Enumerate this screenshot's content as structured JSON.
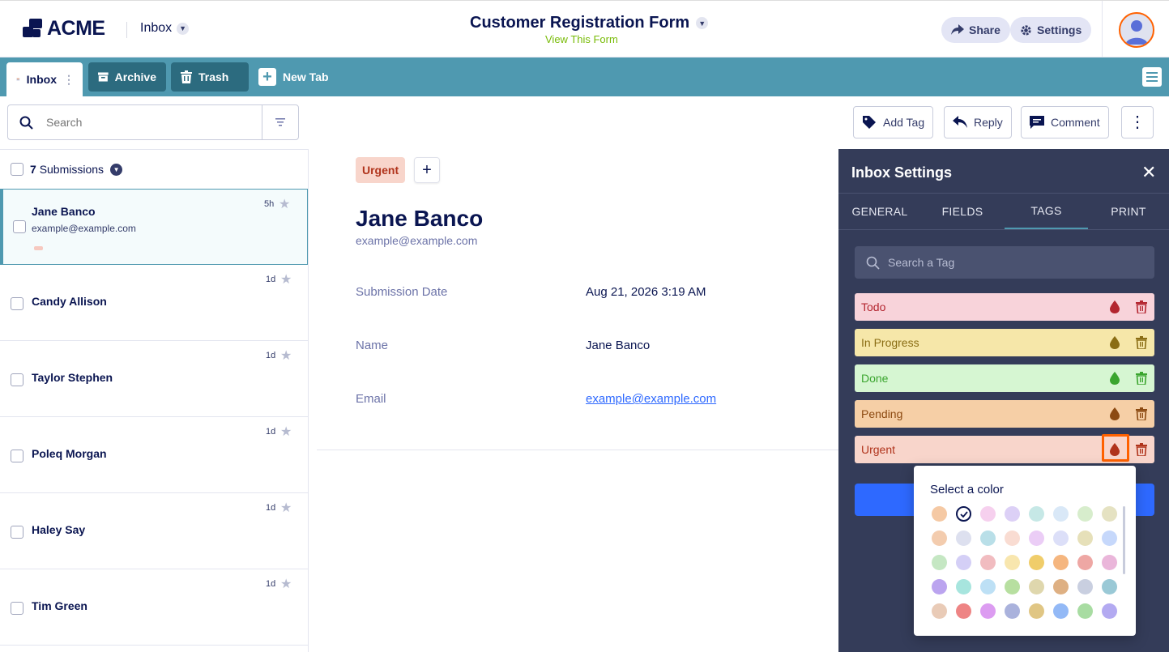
{
  "header": {
    "logo_text": "ACME",
    "inbox_label": "Inbox",
    "form_title": "Customer Registration Form",
    "form_link": "View This Form",
    "share_label": "Share",
    "settings_label": "Settings"
  },
  "tabs": {
    "inbox": "Inbox",
    "archive": "Archive",
    "trash": "Trash",
    "new_tab": "New Tab"
  },
  "toolbar": {
    "search_placeholder": "Search",
    "add_tag": "Add Tag",
    "reply": "Reply",
    "comment": "Comment"
  },
  "list": {
    "count": "7",
    "count_label": "Submissions",
    "rows": [
      {
        "name": "Jane Banco",
        "email": "example@example.com",
        "age": "5h"
      },
      {
        "name": "Candy Allison",
        "age": "1d"
      },
      {
        "name": "Taylor Stephen",
        "age": "1d"
      },
      {
        "name": "Poleq Morgan",
        "age": "1d"
      },
      {
        "name": "Haley Say",
        "age": "1d"
      },
      {
        "name": "Tim Green",
        "age": "1d"
      }
    ]
  },
  "detail": {
    "tag": "Urgent",
    "name": "Jane Banco",
    "email": "example@example.com",
    "fields": [
      {
        "label": "Submission Date",
        "value": "Aug 21, 2026 3:19 AM"
      },
      {
        "label": "Name",
        "value": "Jane Banco"
      },
      {
        "label": "Email",
        "value": "example@example.com"
      }
    ]
  },
  "settings": {
    "title": "Inbox Settings",
    "tabs": [
      "GENERAL",
      "FIELDS",
      "TAGS",
      "PRINT"
    ],
    "active_tab": "TAGS",
    "tag_search_placeholder": "Search a Tag",
    "tags": [
      {
        "name": "Todo",
        "bg": "#f8d3da",
        "fg": "#b3252f"
      },
      {
        "name": "In Progress",
        "bg": "#f6e7a9",
        "fg": "#8a6d14"
      },
      {
        "name": "Done",
        "bg": "#d6f6d2",
        "fg": "#3aa52e"
      },
      {
        "name": "Pending",
        "bg": "#f6cfa6",
        "fg": "#8c4a12"
      },
      {
        "name": "Urgent",
        "bg": "#f8d5cb",
        "fg": "#b0331b"
      }
    ]
  },
  "color_picker": {
    "title": "Select a color",
    "selected_index": 1,
    "colors": [
      "#f5c9a4",
      "#ffffff",
      "#f6d0ee",
      "#dcd0f6",
      "#c6e8e6",
      "#d9e8f7",
      "#d7edcc",
      "#e5e2c2",
      "#f3ccae",
      "#dde0ef",
      "#b9dfe8",
      "#f9dcd2",
      "#ebcdf6",
      "#dcdff8",
      "#e6e0b9",
      "#c6d8fb",
      "#c5e7c3",
      "#d4cff6",
      "#f1bcc0",
      "#f8e6ae",
      "#f0cd6a",
      "#f5b67f",
      "#eea7a4",
      "#eab6da",
      "#bba4ef",
      "#a7e5de",
      "#bde0f5",
      "#b7dfa0",
      "#dfd7ad",
      "#deb083",
      "#c9cfe0",
      "#9ac9d6",
      "#e9cbb7",
      "#ee8484",
      "#dc9cf1",
      "#aab2dc",
      "#e0c684",
      "#93b9f6",
      "#a8dca2",
      "#b3aaf1"
    ]
  }
}
